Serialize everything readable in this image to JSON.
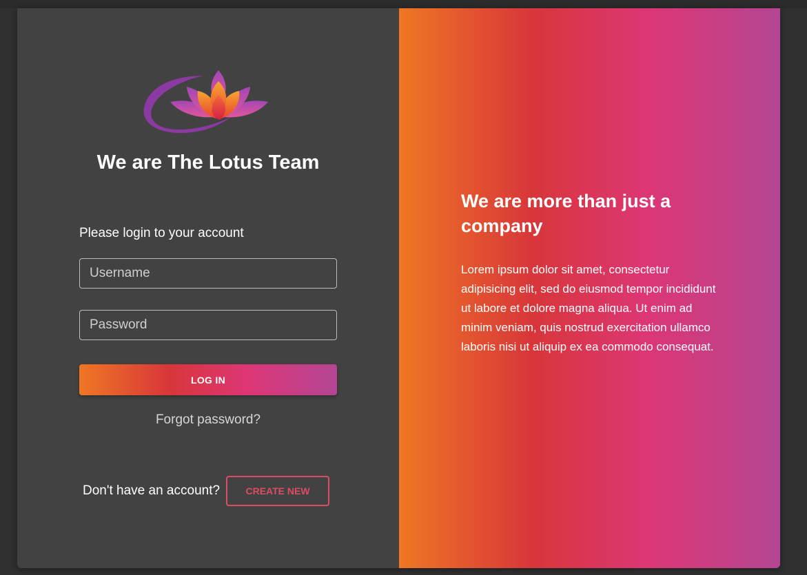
{
  "brand": {
    "logo_icon": "lotus-icon",
    "title": "We are The Lotus Team"
  },
  "login": {
    "prompt": "Please login to your account",
    "username_placeholder": "Username",
    "password_placeholder": "Password",
    "login_button": "LOG IN",
    "forgot_link": "Forgot password?"
  },
  "signup": {
    "question": "Don't have an account?",
    "create_button": "CREATE NEW"
  },
  "promo": {
    "title": "We are more than just a company",
    "body": "Lorem ipsum dolor sit amet, consectetur adipisicing elit, sed do eiusmod tempor incididunt ut labore et dolore magna aliqua. Ut enim ad minim veniam, quis nostrud exercitation ullamco laboris nisi ut aliquip ex ea commodo consequat."
  },
  "colors": {
    "gradient": [
      "#ee7724",
      "#d8363a",
      "#dd3675",
      "#b44593"
    ],
    "accent_outline": "#dc4c64",
    "panel_bg": "#424242"
  }
}
